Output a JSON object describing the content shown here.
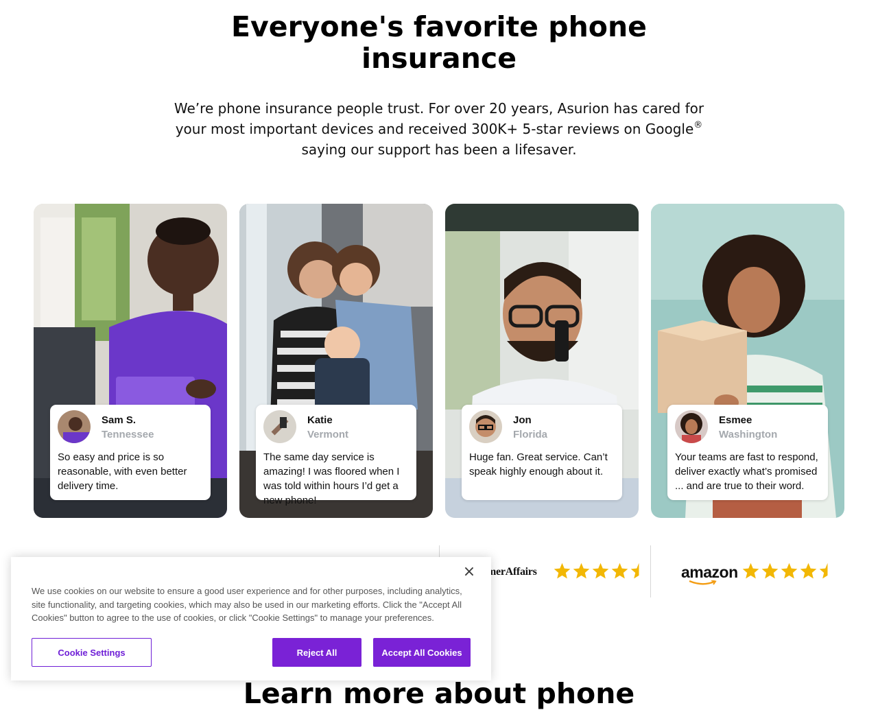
{
  "hero": {
    "title_line1": "Everyone's favorite phone",
    "title_line2": "insurance",
    "subtitle": "We’re phone insurance people trust. For over 20 years, Asurion has cared for your most important devices and received 300K+ 5-star reviews on Google",
    "subtitle_sup": "®",
    "subtitle_end": " saying our support has been a lifesaver."
  },
  "reviews": [
    {
      "name": "Sam S.",
      "location": "Tennessee",
      "text": "So easy and price is so reasonable, with even better delivery time."
    },
    {
      "name": "Katie",
      "location": "Vermont",
      "text": "The same day service is amazing! I was floored when I was told within hours I’d get a new phone!"
    },
    {
      "name": "Jon",
      "location": "Florida",
      "text": "Huge fan. Great service. Can’t speak highly enough about it."
    },
    {
      "name": "Esmee",
      "location": "Washington",
      "text": "Your teams are fast to respond, deliver exactly what’s promised ... and are true to their word."
    }
  ],
  "ratings": [
    {
      "source": "merAffairs",
      "stars": 4.5
    },
    {
      "source": "amazon",
      "stars": 4.5
    }
  ],
  "learn_more_title": "Learn more about phone",
  "cookie": {
    "close_symbol": "×",
    "text": "We use cookies on our website to ensure a good user experience and for other purposes, including analytics, site functionality, and targeting cookies, which may also be used in our marketing efforts. Click the \"Accept All Cookies\" button to agree to the use of cookies, or click \"Cookie Settings\" to manage your preferences.",
    "settings_label": "Cookie Settings",
    "reject_label": "Reject All",
    "accept_label": "Accept All Cookies"
  },
  "colors": {
    "accent_purple": "#7a22d6",
    "star_gold": "#f2b705",
    "location_gray": "#a4a8ad"
  }
}
